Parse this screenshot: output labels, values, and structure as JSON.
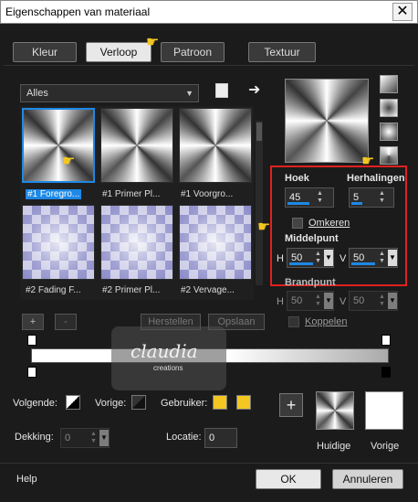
{
  "window": {
    "title": "Eigenschappen van materiaal",
    "close_glyph": "✕"
  },
  "tabs": [
    {
      "label": "Kleur"
    },
    {
      "label": "Verloop"
    },
    {
      "label": "Patroon"
    },
    {
      "label": "Textuur"
    }
  ],
  "library": {
    "dropdown_value": "Alles",
    "items": [
      {
        "label": "#1 Foregro...",
        "style": "conic",
        "selected": true
      },
      {
        "label": "#1 Primer Pl...",
        "style": "conic",
        "selected": false
      },
      {
        "label": "#1 Voorgro...",
        "style": "conic",
        "selected": false
      },
      {
        "label": "#2 Fading F...",
        "style": "checker",
        "selected": false
      },
      {
        "label": "#2 Primer Pl...",
        "style": "checker",
        "selected": false
      },
      {
        "label": "#2 Vervage...",
        "style": "checker",
        "selected": false
      }
    ]
  },
  "settings": {
    "angle_label": "Hoek",
    "angle_value": "45",
    "repeats_label": "Herhalingen",
    "repeats_value": "5",
    "reverse_label": "Omkeren",
    "center_label": "Middelpunt",
    "h_label": "H",
    "center_h_value": "50",
    "v_label": "V",
    "center_v_value": "50",
    "focal_label": "Brandpunt",
    "focal_h_value": "50",
    "focal_v_value": "50",
    "link_label": "Koppelen"
  },
  "gradient_editor": {
    "add_label": "+",
    "remove_label": "-",
    "restore_label": "Herstellen",
    "save_label": "Opslaan"
  },
  "colors": {
    "next_label": "Volgende:",
    "prev_label": "Vorige:",
    "user_label": "Gebruiker:",
    "opacity_label": "Dekking:",
    "opacity_value": "0",
    "location_label": "Locatie:",
    "location_value": "0",
    "user_color": "#f3c621",
    "accent": "#1e88e5"
  },
  "previews": {
    "current_label": "Huidige",
    "previous_label": "Vorige"
  },
  "footer": {
    "help_label": "Help",
    "ok_label": "OK",
    "cancel_label": "Annuleren"
  },
  "watermark": {
    "name_text": "claudia",
    "sub_text": "creations"
  },
  "icons": {
    "pointer": "hand-pointer-icon",
    "arrow": "arrow-right-icon",
    "copy": "copy-icon"
  }
}
